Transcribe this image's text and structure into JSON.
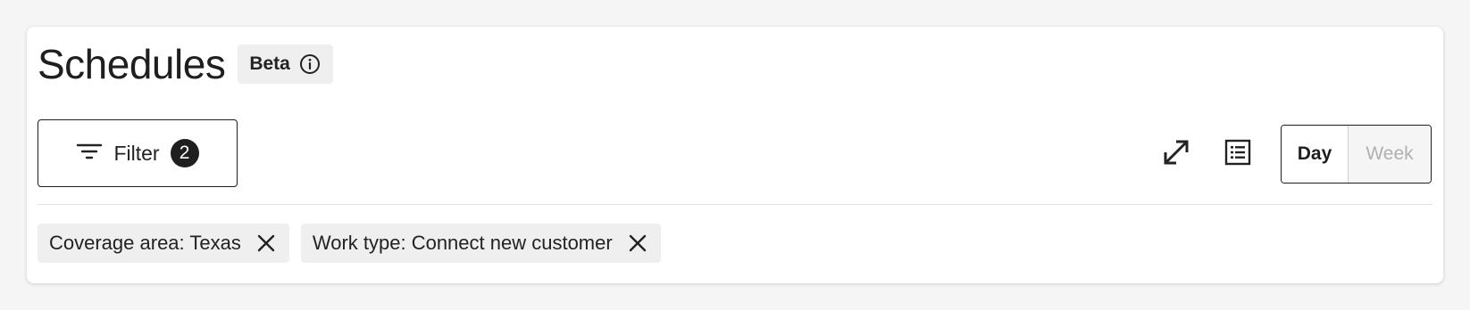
{
  "header": {
    "title": "Schedules",
    "badge_label": "Beta",
    "badge_icon": "info-icon"
  },
  "toolbar": {
    "filter_label": "Filter",
    "filter_count": "2",
    "filter_icon": "filter-lines-icon",
    "expand_icon": "expand-arrows-icon",
    "list_icon": "list-view-icon",
    "view_options": [
      "Day",
      "Week"
    ],
    "selected_view": "Day"
  },
  "active_filters": [
    {
      "label": "Coverage area: Texas",
      "icon": "close-icon"
    },
    {
      "label": "Work type: Connect new customer",
      "icon": "close-icon"
    }
  ],
  "colors": {
    "background": "#f5f5f5",
    "card": "#ffffff",
    "text": "#222222",
    "chip_bg": "#efefef",
    "inactive_text": "#b0b0b0"
  }
}
